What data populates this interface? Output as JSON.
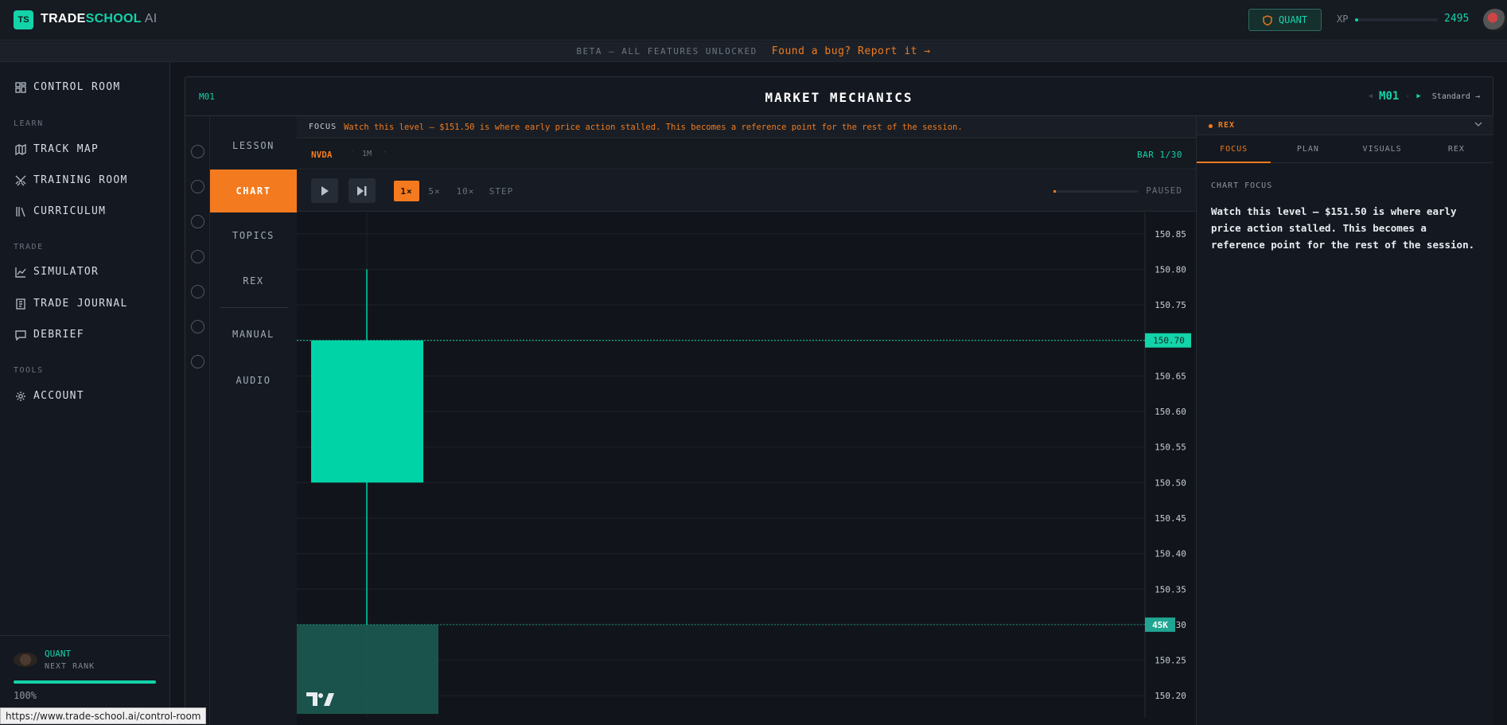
{
  "header": {
    "logo_badge": "TS",
    "brand_trade": "TRADE",
    "brand_school": "SCHOOL",
    "brand_ai": " AI",
    "rank_chip": "QUANT",
    "xp_label": "XP",
    "xp_value": "2495",
    "xp_progress": 0.04
  },
  "beta": {
    "text": "BETA — ALL FEATURES UNLOCKED",
    "bug_link": "Found a bug? Report it →"
  },
  "sidebar": {
    "items": [
      {
        "label": "CONTROL ROOM",
        "icon": "grid-icon"
      },
      {
        "label": "TRACK MAP",
        "icon": "map-icon"
      },
      {
        "label": "TRAINING ROOM",
        "icon": "swords-icon"
      },
      {
        "label": "CURRICULUM",
        "icon": "library-icon"
      },
      {
        "label": "SIMULATOR",
        "icon": "chart-line-icon"
      },
      {
        "label": "TRADE JOURNAL",
        "icon": "notebook-icon"
      },
      {
        "label": "DEBRIEF",
        "icon": "message-icon"
      },
      {
        "label": "ACCOUNT",
        "icon": "gear-icon"
      }
    ],
    "sections": {
      "learn": "LEARN",
      "trade": "TRADE",
      "tools": "TOOLS"
    },
    "rank": {
      "title": "QUANT",
      "subtitle": "NEXT RANK",
      "percent": "100%",
      "progress": 1.0
    }
  },
  "status_url": "https://www.trade-school.ai/control-room",
  "module": {
    "code_left": "M01",
    "title": "MARKET MECHANICS",
    "nav_code": "M01",
    "mode": "Standard →"
  },
  "lesson_tabs": [
    {
      "label": "LESSON",
      "active": false
    },
    {
      "label": "CHART",
      "active": true
    },
    {
      "label": "TOPICS",
      "active": false
    },
    {
      "label": "REX",
      "active": false
    },
    {
      "label": "MANUAL",
      "active": false
    },
    {
      "label": "AUDIO",
      "active": false
    }
  ],
  "focus": {
    "label": "FOCUS",
    "text": "Watch this level — $151.50 is where early price action stalled. This becomes a reference point for the rest of the session."
  },
  "chart_toolbar": {
    "symbol": "NVDA",
    "timeframe": "1M",
    "bar_count": "BAR 1/30",
    "speeds": [
      "1×",
      "5×",
      "10×",
      "STEP"
    ],
    "active_speed": "1×",
    "status": "PAUSED",
    "progress": 0.033
  },
  "chart_data": {
    "type": "candlestick",
    "symbol": "NVDA",
    "y_ticks": [
      "150.85",
      "150.80",
      "150.75",
      "150.70",
      "150.65",
      "150.60",
      "150.55",
      "150.50",
      "150.45",
      "150.40",
      "150.35",
      "150.30",
      "150.25",
      "150.20"
    ],
    "ylim": [
      150.17,
      150.88
    ],
    "candles": [
      {
        "open": 150.5,
        "high": 150.8,
        "low": 150.3,
        "close": 150.7
      }
    ],
    "volume": [
      {
        "value": 45000
      }
    ],
    "price_label": "150.70",
    "volume_label": "45K",
    "colors": {
      "up": "#00d3a6",
      "volume": "#1c5e54",
      "price_line": "#13d3a9"
    }
  },
  "rex_panel": {
    "title": "REX",
    "tabs": [
      "FOCUS",
      "PLAN",
      "VISUALS",
      "REX"
    ],
    "active_tab": "FOCUS",
    "section_label": "CHART FOCUS",
    "body": "Watch this level — $151.50 is where early price action stalled. This becomes a reference point for the rest of the session."
  },
  "colors": {
    "accent": "#13d3a9",
    "orange": "#f47a1f",
    "background": "#12161c"
  }
}
